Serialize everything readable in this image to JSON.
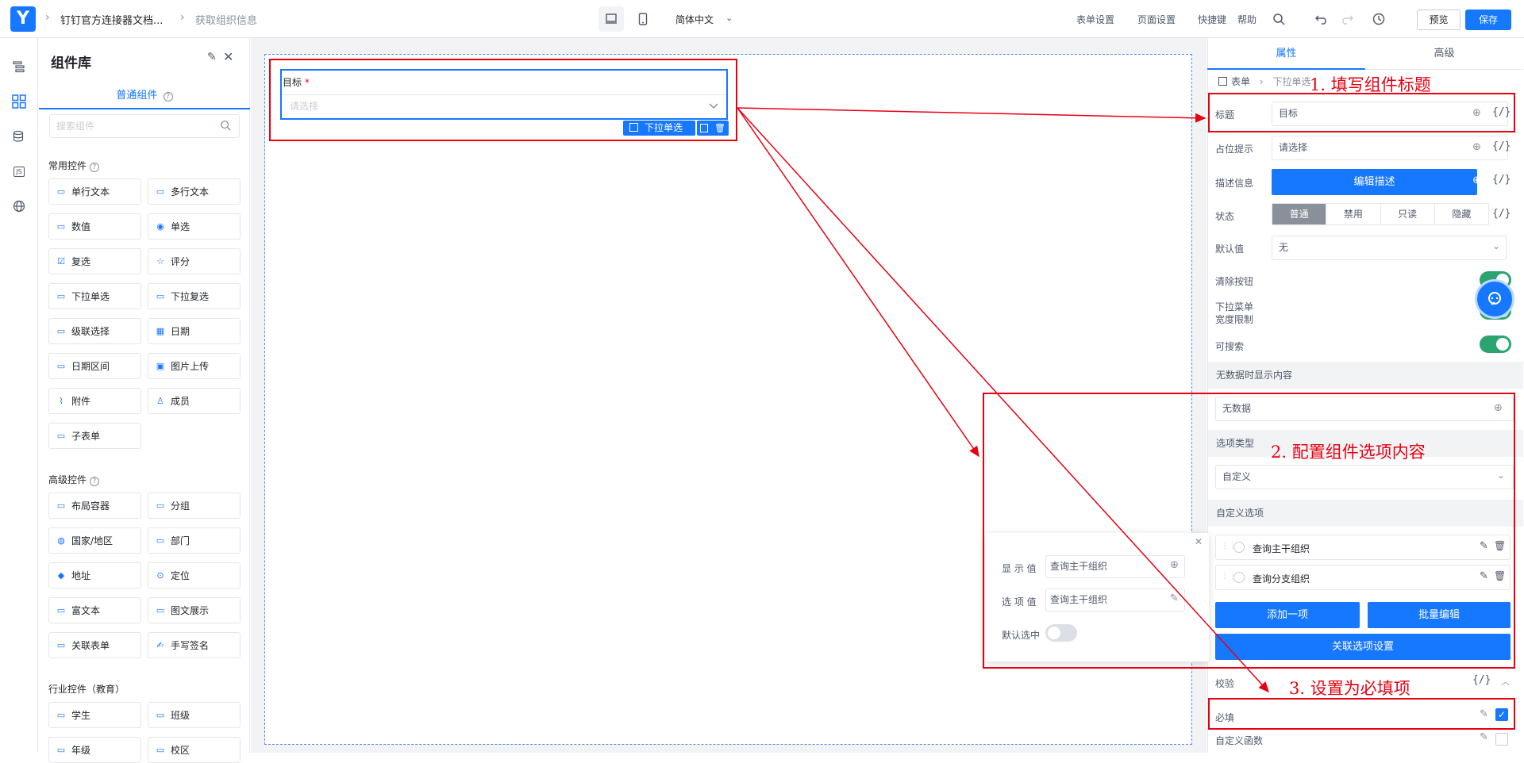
{
  "topbar": {
    "logo": "Y",
    "crumb1": "钉钉官方连接器文档...",
    "crumb2": "获取组织信息",
    "language": "简体中文",
    "form_settings": "表单设置",
    "page_settings": "页面设置",
    "shortcuts": "快捷键",
    "help": "帮助",
    "preview": "预览",
    "save": "保存"
  },
  "rail": {
    "icons": [
      "outline-icon",
      "components-icon",
      "datasource-icon",
      "js-icon",
      "globe-icon"
    ],
    "js_label": "JS"
  },
  "component_panel": {
    "title": "组件库",
    "tab": "普通组件",
    "search_placeholder": "搜索组件",
    "group_common": "常用控件",
    "group_advanced": "高级控件",
    "group_industry": "行业控件（教育）",
    "common": [
      "单行文本",
      "多行文本",
      "数值",
      "单选",
      "复选",
      "评分",
      "下拉单选",
      "下拉复选",
      "级联选择",
      "日期",
      "日期区间",
      "图片上传",
      "附件",
      "成员",
      "子表单"
    ],
    "advanced": [
      "布局容器",
      "分组",
      "国家/地区",
      "部门",
      "地址",
      "定位",
      "富文本",
      "图文展示",
      "关联表单",
      "手写签名"
    ],
    "industry": [
      "学生",
      "班级",
      "年级",
      "校区"
    ]
  },
  "canvas": {
    "field_label": "目标",
    "required_mark": "*",
    "placeholder": "请选择",
    "toolbar_label": "下拉单选"
  },
  "props": {
    "tab_attr": "属性",
    "tab_adv": "高级",
    "crumb_form": "表单",
    "crumb_comp": "下拉单选",
    "title_label": "标题",
    "title_value": "目标",
    "placeholder_label": "占位提示",
    "placeholder_value": "请选择",
    "desc_label": "描述信息",
    "desc_button": "编辑描述",
    "state_label": "状态",
    "states": [
      "普通",
      "禁用",
      "只读",
      "隐藏"
    ],
    "default_label": "默认值",
    "default_value": "无",
    "clear_label": "清除按钮",
    "width_label_1": "下拉菜单",
    "width_label_2": "宽度限制",
    "searchable_label": "可搜索",
    "nodata_section": "无数据时显示内容",
    "nodata_value": "无数据",
    "option_type_section": "选项类型",
    "option_type_value": "自定义",
    "custom_options_section": "自定义选项",
    "options": [
      "查询主干组织",
      "查询分支组织"
    ],
    "add_item": "添加一项",
    "batch_edit": "批量编辑",
    "linkage": "关联选项设置",
    "validation_section": "校验",
    "required_label": "必填",
    "custom_func_label": "自定义函数",
    "curly": "{/}"
  },
  "popup": {
    "display_label": "显 示 值",
    "display_value": "查询主干组织",
    "option_label": "选 项 值",
    "option_value": "查询主干组织",
    "default_label": "默认选中"
  },
  "annotations": {
    "a1": "1. 填写组件标题",
    "a2": "2. 配置组件选项内容",
    "a3": "3. 设置为必填项"
  },
  "colors": {
    "primary": "#1677ff",
    "annotation": "#e60012",
    "toggle_on": "#2ba471"
  }
}
